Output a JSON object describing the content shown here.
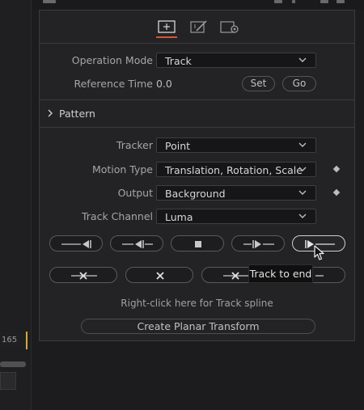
{
  "left": {
    "frame_number": "165"
  },
  "tabs": [
    {
      "name": "tracker-controls-icon",
      "active": true
    },
    {
      "name": "operation-icon",
      "active": false
    },
    {
      "name": "settings-icon",
      "active": false
    }
  ],
  "operation": {
    "mode_label": "Operation Mode",
    "mode_value": "Track",
    "ref_time_label": "Reference Time",
    "ref_time_value": "0.0",
    "set_label": "Set",
    "go_label": "Go"
  },
  "pattern": {
    "section_label": "Pattern"
  },
  "tracker_settings": {
    "tracker_label": "Tracker",
    "tracker_value": "Point",
    "motion_type_label": "Motion Type",
    "motion_type_value": "Translation, Rotation, Scale",
    "output_label": "Output",
    "output_value": "Background",
    "track_channel_label": "Track Channel",
    "track_channel_value": "Luma"
  },
  "track_buttons": [
    {
      "name": "track-to-start-icon"
    },
    {
      "name": "track-backward-one-frame-icon"
    },
    {
      "name": "stop-tracking-icon"
    },
    {
      "name": "track-forward-one-frame-icon"
    },
    {
      "name": "track-to-end-icon"
    }
  ],
  "clear_buttons": [
    {
      "name": "clear-all-icon"
    },
    {
      "name": "clear-icon"
    },
    {
      "name": "clear-before-icon"
    },
    {
      "name": "clear-after-icon"
    }
  ],
  "tooltip": {
    "text": "Track to end"
  },
  "hint": {
    "text": "Right-click here for Track spline"
  },
  "planar": {
    "button_label": "Create Planar Transform"
  },
  "colors": {
    "panel_bg": "#232325",
    "accent": "#d6553a",
    "timeline_marker": "#d6a93a"
  }
}
